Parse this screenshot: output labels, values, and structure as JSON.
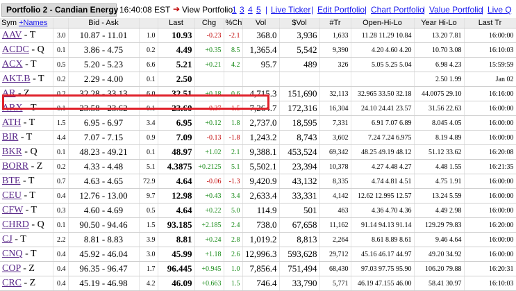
{
  "header": {
    "portfolio_title": "Portfolio 2 - Candian Energy",
    "time": "16:40:08 EST",
    "view_label": "View Portfolio",
    "portfolio_links": [
      "1",
      "3",
      "4",
      "5"
    ],
    "links": [
      "Live Ticker",
      "Edit Portfolio",
      "Chart Portfolio",
      "Value Portfolio",
      "Live Q"
    ]
  },
  "columns": {
    "sym": "Sym",
    "names_link": "+Names",
    "bid_ask": "Bid - Ask",
    "last": "Last",
    "chg": "Chg",
    "pct_chg": "%Ch",
    "vol": "Vol",
    "dollar_vol": "$Vol",
    "trades": "#Tr",
    "open_hi_lo": "Open-Hi-Lo",
    "year_hi_lo": "Year Hi-Lo",
    "last_tr": "Last Tr"
  },
  "rows": [
    {
      "ticker": "AAV",
      "exch": "- T",
      "bid_size": "3.0",
      "bid_ask": "10.87 - 11.01",
      "ask_size": "1.0",
      "last": "10.93",
      "chg": "-0.23",
      "pct": "-2.1",
      "dir": "neg",
      "vol": "368.0",
      "svol": "3,936",
      "tr": "1,633",
      "ohl": "11.28  11.29  10.84",
      "yhl": "13.20  7.81",
      "lt": "16:00:00"
    },
    {
      "ticker": "ACDC",
      "exch": "- Q",
      "bid_size": "0.1",
      "bid_ask": "3.86 - 4.75",
      "ask_size": "0.2",
      "last": "4.49",
      "chg": "+0.35",
      "pct": "8.5",
      "dir": "pos",
      "vol": "1,365.4",
      "svol": "5,542",
      "tr": "9,390",
      "ohl": "4.20  4.60  4.20",
      "yhl": "10.70  3.08",
      "lt": "16:10:03"
    },
    {
      "ticker": "ACX",
      "exch": "- T",
      "bid_size": "0.5",
      "bid_ask": "5.20 - 5.23",
      "ask_size": "6.6",
      "last": "5.21",
      "chg": "+0.21",
      "pct": "4.2",
      "dir": "pos",
      "vol": "95.7",
      "svol": "489",
      "tr": "326",
      "ohl": "5.05  5.25  5.04",
      "yhl": "6.98  4.23",
      "lt": "15:59:59"
    },
    {
      "ticker": "AKT.B",
      "exch": "- T",
      "bid_size": "0.2",
      "bid_ask": "2.29 - 4.00",
      "ask_size": "0.1",
      "last": "2.50",
      "chg": "",
      "pct": "",
      "dir": "",
      "vol": "",
      "svol": "",
      "tr": "",
      "ohl": "",
      "yhl": "2.50  1.99",
      "lt": "Jan 02"
    },
    {
      "ticker": "AR",
      "exch": "- Z",
      "bid_size": "0.2",
      "bid_ask": "32.28 - 33.13",
      "ask_size": "6.0",
      "last": "32.51",
      "chg": "+0.18",
      "pct": "0.6",
      "dir": "pos",
      "vol": "4,715.3",
      "svol": "151,690",
      "tr": "32,113",
      "ohl": "32.965  33.50  32.18",
      "yhl": "44.0075  29.10",
      "lt": "16:16:00"
    },
    {
      "ticker": "ARX",
      "exch": "- T",
      "bid_size": "0.1",
      "bid_ask": "23.58 - 23.62",
      "ask_size": "0.1",
      "last": "23.60",
      "chg": "-0.37",
      "pct": "-1.5",
      "dir": "neg",
      "vol": "7,264.7",
      "svol": "172,316",
      "tr": "16,304",
      "ohl": "24.10  24.41  23.57",
      "yhl": "31.56  22.63",
      "lt": "16:00:00"
    },
    {
      "ticker": "ATH",
      "exch": "- T",
      "bid_size": "1.5",
      "bid_ask": "6.95 - 6.97",
      "ask_size": "3.4",
      "last": "6.95",
      "chg": "+0.12",
      "pct": "1.8",
      "dir": "pos",
      "vol": "2,737.0",
      "svol": "18,595",
      "tr": "7,331",
      "ohl": "6.91  7.07  6.89",
      "yhl": "8.045  4.05",
      "lt": "16:00:00"
    },
    {
      "ticker": "BIR",
      "exch": "- T",
      "bid_size": "4.4",
      "bid_ask": "7.07 - 7.15",
      "ask_size": "0.9",
      "last": "7.09",
      "chg": "-0.13",
      "pct": "-1.8",
      "dir": "neg",
      "vol": "1,243.2",
      "svol": "8,743",
      "tr": "3,602",
      "ohl": "7.24  7.24  6.975",
      "yhl": "8.19  4.89",
      "lt": "16:00:00"
    },
    {
      "ticker": "BKR",
      "exch": "- Q",
      "bid_size": "0.1",
      "bid_ask": "48.23 - 49.21",
      "ask_size": "0.1",
      "last": "48.97",
      "chg": "+1.02",
      "pct": "2.1",
      "dir": "pos",
      "vol": "9,388.1",
      "svol": "453,524",
      "tr": "69,342",
      "ohl": "48.25  49.19  48.12",
      "yhl": "51.12  33.62",
      "lt": "16:20:08"
    },
    {
      "ticker": "BORR",
      "exch": "- Z",
      "bid_size": "0.2",
      "bid_ask": "4.33 - 4.48",
      "ask_size": "5.1",
      "last": "4.3875",
      "chg": "+0.2125",
      "pct": "5.1",
      "dir": "pos",
      "vol": "5,502.1",
      "svol": "23,394",
      "tr": "10,378",
      "ohl": "4.27  4.48  4.27",
      "yhl": "4.48  1.55",
      "lt": "16:21:35"
    },
    {
      "ticker": "BTE",
      "exch": "- T",
      "bid_size": "0.7",
      "bid_ask": "4.63 - 4.65",
      "ask_size": "72.9",
      "last": "4.64",
      "chg": "-0.06",
      "pct": "-1.3",
      "dir": "neg",
      "vol": "9,420.9",
      "svol": "43,132",
      "tr": "8,335",
      "ohl": "4.74  4.81  4.51",
      "yhl": "4.75  1.91",
      "lt": "16:00:00"
    },
    {
      "ticker": "CEU",
      "exch": "- T",
      "bid_size": "0.4",
      "bid_ask": "12.76 - 13.00",
      "ask_size": "9.7",
      "last": "12.98",
      "chg": "+0.43",
      "pct": "3.4",
      "dir": "pos",
      "vol": "2,633.4",
      "svol": "33,331",
      "tr": "4,142",
      "ohl": "12.62  12.995  12.57",
      "yhl": "13.24  5.59",
      "lt": "16:00:00"
    },
    {
      "ticker": "CFW",
      "exch": "- T",
      "bid_size": "0.3",
      "bid_ask": "4.60 - 4.69",
      "ask_size": "0.5",
      "last": "4.64",
      "chg": "+0.22",
      "pct": "5.0",
      "dir": "pos",
      "vol": "114.9",
      "svol": "501",
      "tr": "463",
      "ohl": "4.36  4.70  4.36",
      "yhl": "4.49  2.98",
      "lt": "16:00:00"
    },
    {
      "ticker": "CHRD",
      "exch": "- Q",
      "bid_size": "0.1",
      "bid_ask": "90.50 - 94.46",
      "ask_size": "1.5",
      "last": "93.185",
      "chg": "+2.185",
      "pct": "2.4",
      "dir": "pos",
      "vol": "738.0",
      "svol": "67,658",
      "tr": "11,162",
      "ohl": "91.14  94.13  91.14",
      "yhl": "129.29  79.83",
      "lt": "16:20:00"
    },
    {
      "ticker": "CJ",
      "exch": "- T",
      "bid_size": "2.2",
      "bid_ask": "8.81 - 8.83",
      "ask_size": "3.9",
      "last": "8.81",
      "chg": "+0.24",
      "pct": "2.8",
      "dir": "pos",
      "vol": "1,019.2",
      "svol": "8,813",
      "tr": "2,264",
      "ohl": "8.61  8.89  8.61",
      "yhl": "9.46  4.64",
      "lt": "16:00:00"
    },
    {
      "ticker": "CNQ",
      "exch": "- T",
      "bid_size": "0.4",
      "bid_ask": "45.92 - 46.04",
      "ask_size": "3.0",
      "last": "45.99",
      "chg": "+1.18",
      "pct": "2.6",
      "dir": "pos",
      "vol": "12,996.3",
      "svol": "593,628",
      "tr": "29,712",
      "ohl": "45.16  46.17  44.97",
      "yhl": "49.20  34.92",
      "lt": "16:00:00"
    },
    {
      "ticker": "COP",
      "exch": "- Z",
      "bid_size": "0.4",
      "bid_ask": "96.35 - 96.47",
      "ask_size": "1.7",
      "last": "96.445",
      "chg": "+0.945",
      "pct": "1.0",
      "dir": "pos",
      "vol": "7,856.4",
      "svol": "751,494",
      "tr": "68,430",
      "ohl": "97.03  97.75  95.90",
      "yhl": "106.20  79.88",
      "lt": "16:20:31"
    },
    {
      "ticker": "CRC",
      "exch": "- Z",
      "bid_size": "0.4",
      "bid_ask": "45.19 - 46.98",
      "ask_size": "4.2",
      "last": "46.09",
      "chg": "+0.663",
      "pct": "1.5",
      "dir": "pos",
      "vol": "746.4",
      "svol": "33,790",
      "tr": "5,771",
      "ohl": "46.19  47.155  46.00",
      "yhl": "58.41  30.97",
      "lt": "16:10:03"
    }
  ],
  "colors": {
    "positive": "#178a17",
    "negative": "#c00000",
    "highlight_border": "#e0202a",
    "ticker_link": "#5b2a8a"
  }
}
